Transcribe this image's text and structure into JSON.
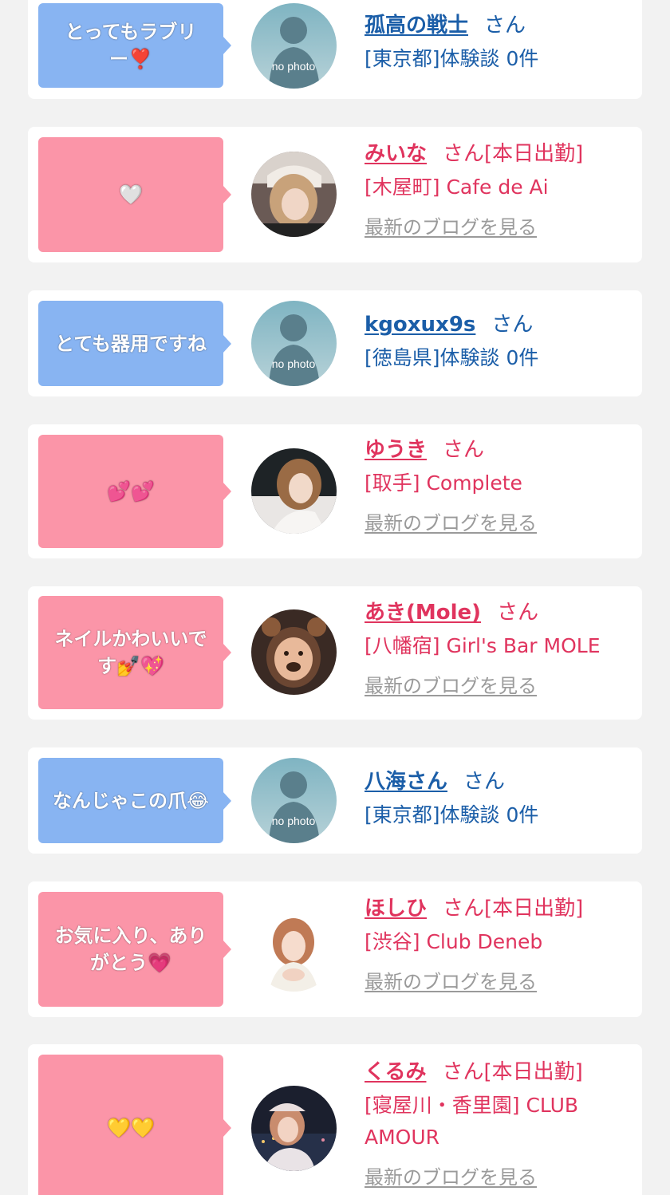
{
  "items": [
    {
      "message": [
        "とってもラブリ",
        "ー❣️"
      ],
      "bubble_color": "#88b4f2",
      "avatar": "no-photo",
      "avatar_caption": "no photo",
      "name": "孤高の戦士",
      "san": "さん",
      "sub": "[東京都]体験談 0件"
    },
    {
      "message": [
        "🤍"
      ],
      "bubble_color": "#fb95a8",
      "avatar": "photo",
      "name": "みいな",
      "san": "さん",
      "status": "[本日出勤]",
      "sub": "[木屋町] Cafe de Ai",
      "blog": "最新のブログを見る"
    },
    {
      "message": [
        "とても器用ですね"
      ],
      "bubble_color": "#88b4f2",
      "avatar": "no-photo",
      "avatar_caption": "no photo",
      "name": "kgoxux9s",
      "san": "さん",
      "sub": "[徳島県]体験談 0件"
    },
    {
      "message": [
        "💕💕"
      ],
      "bubble_color": "#fb95a8",
      "avatar": "photo",
      "name": "ゆうき",
      "san": "さん",
      "sub": "[取手] Complete",
      "blog": "最新のブログを見る"
    },
    {
      "message": [
        "ネイルかわいいで",
        "す💅💖"
      ],
      "bubble_color": "#fb95a8",
      "avatar": "photo",
      "name": "あき(Mole)",
      "san": "さん",
      "sub": "[八幡宿] Girl's Bar MOLE",
      "blog": "最新のブログを見る"
    },
    {
      "message": [
        "なんじゃこの爪😂"
      ],
      "bubble_color": "#88b4f2",
      "avatar": "no-photo",
      "avatar_caption": "no photo",
      "name": "八海さん",
      "san": "さん",
      "sub": "[東京都]体験談 0件"
    },
    {
      "message": [
        "お気に入り、あり",
        "がとう💗"
      ],
      "bubble_color": "#fb95a8",
      "avatar": "photo",
      "name": "ほしひ",
      "san": "さん",
      "status": "[本日出勤]",
      "sub": "[渋谷] Club Deneb",
      "blog": "最新のブログを見る"
    },
    {
      "message": [
        "💛💛"
      ],
      "bubble_color": "#fb95a8",
      "avatar": "photo",
      "name": "くるみ",
      "san": "さん",
      "status": "[本日出勤]",
      "sub": [
        "[寝屋川・香里園] CLUB",
        "AMOUR"
      ],
      "blog": "最新のブログを見る"
    }
  ]
}
